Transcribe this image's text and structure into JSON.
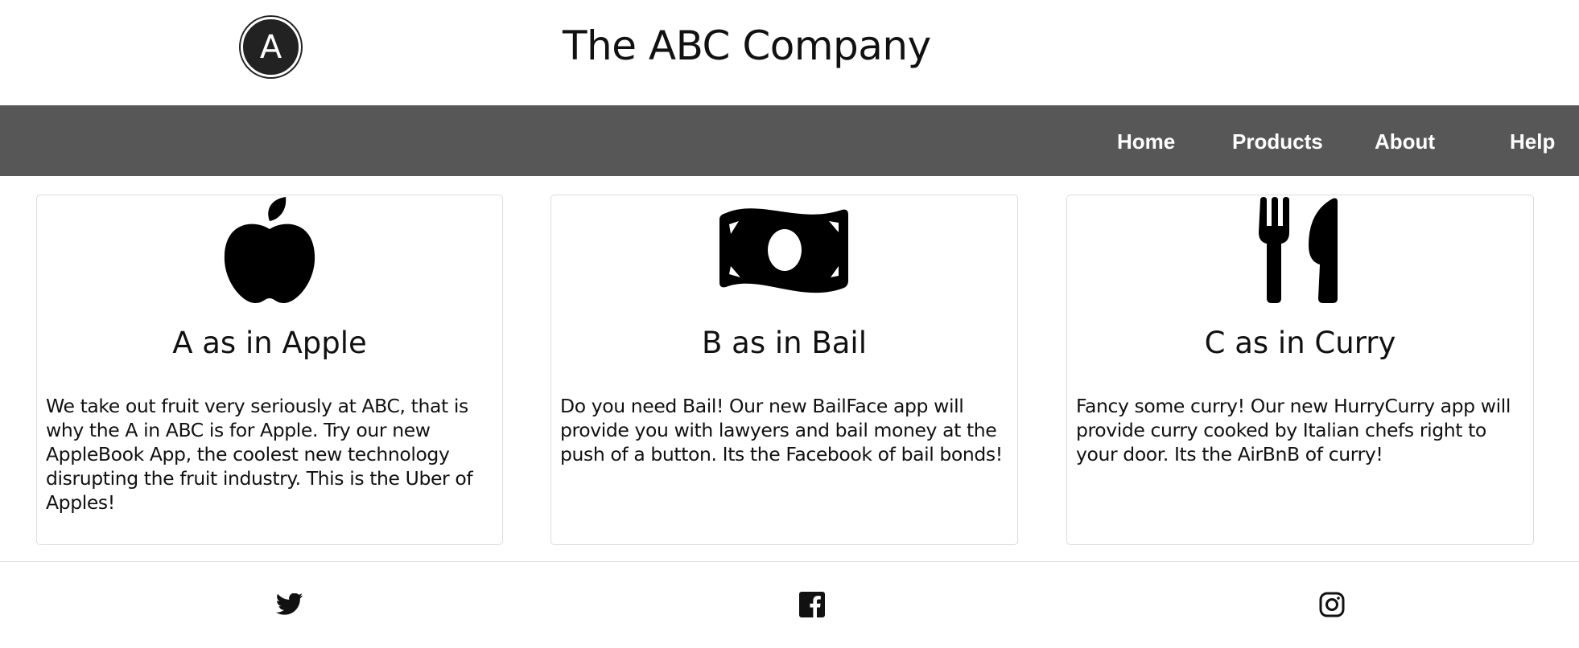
{
  "header": {
    "logo_letter": "A",
    "title": "The ABC Company"
  },
  "nav": {
    "items": [
      {
        "label": "Home"
      },
      {
        "label": "Products"
      },
      {
        "label": "About"
      },
      {
        "label": "Help"
      }
    ]
  },
  "cards": [
    {
      "icon": "apple-icon",
      "title": "A as in Apple",
      "text": "We take out fruit very seriously at ABC, that is why the A in ABC is for Apple. Try our new AppleBook App, the coolest new technology disrupting the fruit industry. This is the Uber of Apples!"
    },
    {
      "icon": "money-bill-icon",
      "title": "B as in Bail",
      "text": "Do you need Bail! Our new BailFace app will provide you with lawyers and bail money at the push of a button. Its the Facebook of bail bonds!"
    },
    {
      "icon": "utensils-icon",
      "title": "C as in Curry",
      "text": "Fancy some curry! Our new HurryCurry app will provide curry cooked by Italian chefs right to your door. Its the AirBnB of curry!"
    }
  ],
  "footer": {
    "social": [
      "twitter-icon",
      "facebook-icon",
      "instagram-icon"
    ]
  },
  "colors": {
    "navbar_bg": "#575757",
    "nav_text": "#ffffff",
    "logo_bg": "#222222",
    "card_border": "#dcdcdc"
  }
}
